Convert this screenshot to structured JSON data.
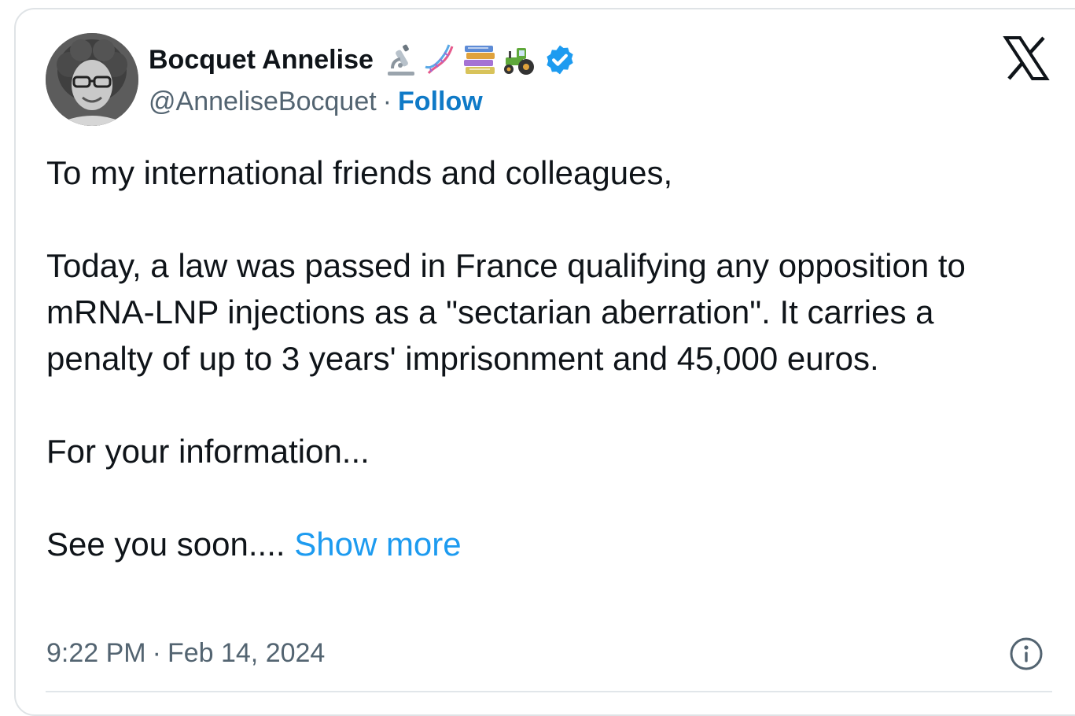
{
  "author": {
    "display_name": "Bocquet Annelise",
    "handle": "@AnneliseBocquet",
    "separator": "·",
    "follow_label": "Follow",
    "name_emojis": [
      "microscope-emoji",
      "dna-emoji",
      "books-emoji",
      "tractor-emoji"
    ],
    "verified_icon": "verified-badge-icon"
  },
  "platform_icon": "x-logo-icon",
  "tweet": {
    "paragraphs": [
      "To my international friends and colleagues,",
      "Today, a law was passed in France qualifying any opposition to mRNA-LNP injections as a \"sectarian aberration\". It carries a penalty of up to 3 years' imprisonment and 45,000 euros.",
      "For your information...",
      "See you soon...."
    ],
    "show_more_label": "Show more"
  },
  "meta": {
    "time": "9:22 PM",
    "separator": "·",
    "date": "Feb 14, 2024",
    "info_icon": "info-icon"
  },
  "colors": {
    "text": "#0f1419",
    "secondary_text": "#536471",
    "follow_link": "#0f7ac7",
    "show_more_link": "#1d9bf0",
    "verified_badge": "#1d9bf0",
    "card_border": "#dfe3e6"
  }
}
